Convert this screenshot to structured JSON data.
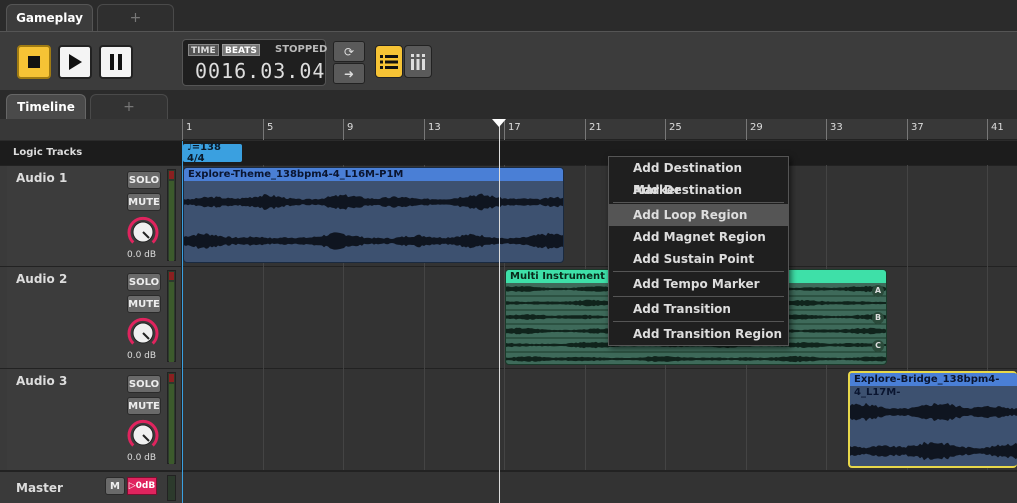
{
  "tabs": {
    "main": "Gameplay",
    "add": "+"
  },
  "clock": {
    "time_label": "TIME",
    "beats_label": "BEATS",
    "status": "STOPPED",
    "counter": "0016.03.04"
  },
  "subtabs": {
    "active": "Timeline",
    "add": "+"
  },
  "ruler": {
    "bars": [
      "1",
      "5",
      "9",
      "13",
      "17",
      "21",
      "25",
      "29",
      "33",
      "37",
      "41"
    ]
  },
  "logic": {
    "label": "Logic Tracks",
    "tempo": "♩=138 4/4"
  },
  "tracks": [
    {
      "name": "Audio 1",
      "solo": "SOLO",
      "mute": "MUTE",
      "db": "0.0 dB"
    },
    {
      "name": "Audio 2",
      "solo": "SOLO",
      "mute": "MUTE",
      "db": "0.0 dB"
    },
    {
      "name": "Audio 3",
      "solo": "SOLO",
      "mute": "MUTE",
      "db": "0.0 dB"
    }
  ],
  "clips": {
    "c1": "Explore-Theme_138bpm4-4_L16M-P1M",
    "c2": "Multi Instrument",
    "c2_labels": [
      "A",
      "B",
      "C"
    ],
    "c3": "Explore-Bridge_138bpm4-4_L17M-"
  },
  "master": {
    "name": "Master",
    "m": "M",
    "db": "▷0dB"
  },
  "menu": {
    "items": [
      "Add Destination Marker",
      "Add Destination Region",
      "Add Loop Region",
      "Add Magnet Region",
      "Add Sustain Point",
      "Add Tempo Marker",
      "Add Transition",
      "Add Transition Region"
    ]
  },
  "colors": {
    "accent_yellow": "#f6c335",
    "clip_blue": "#4a7fd6",
    "clip_teal": "#3ee0a8",
    "tempo_blue": "#3aa0e0",
    "master_red": "#e0245e"
  }
}
